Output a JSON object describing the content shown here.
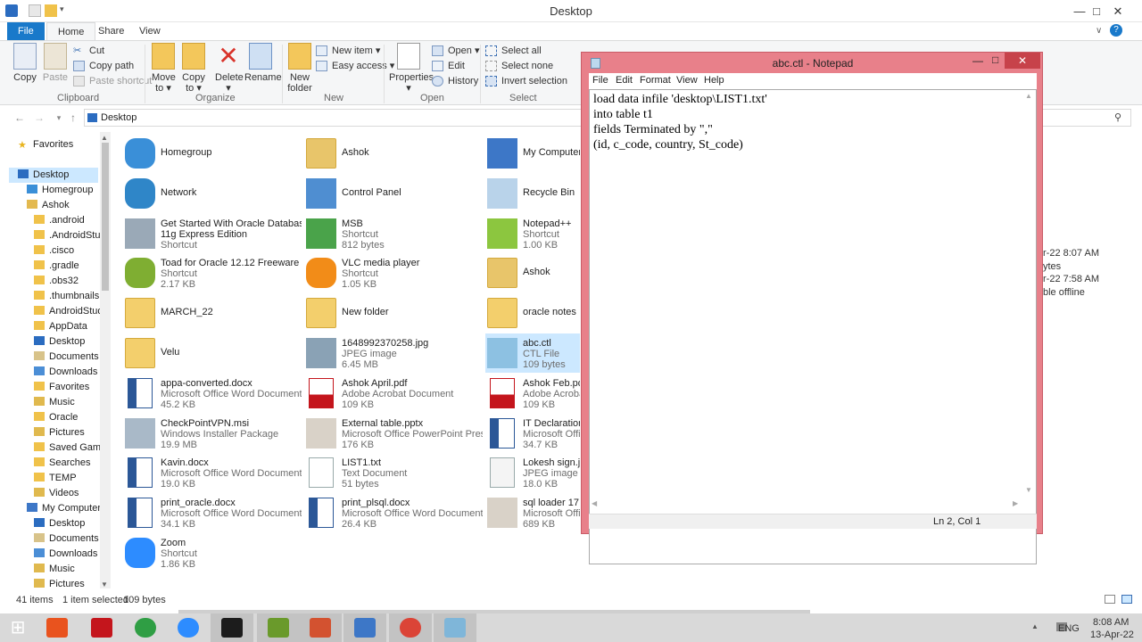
{
  "window": {
    "title": "Desktop"
  },
  "ribbon_tabs": [
    "File",
    "Home",
    "Share",
    "View"
  ],
  "ribbon": {
    "clipboard": {
      "label": "Clipboard",
      "copy": "Copy",
      "paste": "Paste",
      "cut": "Cut",
      "copy_path": "Copy path",
      "paste_shortcut": "Paste shortcut"
    },
    "organize": {
      "label": "Organize",
      "move_to_1": "Move",
      "move_to_2": "to ▾",
      "copy_to_1": "Copy",
      "copy_to_2": "to ▾",
      "delete_1": "Delete",
      "delete_2": "▾",
      "rename": "Rename"
    },
    "new": {
      "label": "New",
      "new_folder_1": "New",
      "new_folder_2": "folder",
      "new_item": "New item ▾",
      "easy_access": "Easy access ▾"
    },
    "open": {
      "label": "Open",
      "properties_1": "Properties",
      "properties_2": "▾",
      "open": "Open ▾",
      "edit": "Edit",
      "history": "History"
    },
    "select": {
      "label": "Select",
      "select_all": "Select all",
      "select_none": "Select none",
      "invert": "Invert selection"
    }
  },
  "address": {
    "path": "Desktop"
  },
  "nav": [
    {
      "label": "Favorites",
      "level": 0,
      "icon": "star-icon"
    },
    {
      "label": "Desktop",
      "level": 0,
      "icon": "desktop-icon",
      "selected": true
    },
    {
      "label": "Homegroup",
      "level": 1,
      "icon": "homegroup-icon"
    },
    {
      "label": "Ashok",
      "level": 1,
      "icon": "user-folder-icon"
    },
    {
      "label": ".android",
      "level": 2,
      "icon": "folder-icon"
    },
    {
      "label": ".AndroidStud",
      "level": 2,
      "icon": "folder-icon"
    },
    {
      "label": ".cisco",
      "level": 2,
      "icon": "folder-icon"
    },
    {
      "label": ".gradle",
      "level": 2,
      "icon": "folder-icon"
    },
    {
      "label": ".obs32",
      "level": 2,
      "icon": "folder-icon"
    },
    {
      "label": ".thumbnails",
      "level": 2,
      "icon": "folder-icon"
    },
    {
      "label": "AndroidStudi",
      "level": 2,
      "icon": "folder-icon"
    },
    {
      "label": "AppData",
      "level": 2,
      "icon": "folder-icon"
    },
    {
      "label": "Desktop",
      "level": 2,
      "icon": "desktop-icon"
    },
    {
      "label": "Documents",
      "level": 2,
      "icon": "documents-icon"
    },
    {
      "label": "Downloads",
      "level": 2,
      "icon": "downloads-icon"
    },
    {
      "label": "Favorites",
      "level": 2,
      "icon": "folder-icon"
    },
    {
      "label": "Music",
      "level": 2,
      "icon": "music-icon"
    },
    {
      "label": "Oracle",
      "level": 2,
      "icon": "folder-icon"
    },
    {
      "label": "Pictures",
      "level": 2,
      "icon": "pictures-icon"
    },
    {
      "label": "Saved Games",
      "level": 2,
      "icon": "folder-icon"
    },
    {
      "label": "Searches",
      "level": 2,
      "icon": "folder-icon"
    },
    {
      "label": "TEMP",
      "level": 2,
      "icon": "folder-icon"
    },
    {
      "label": "Videos",
      "level": 2,
      "icon": "videos-icon"
    },
    {
      "label": "My Computer",
      "level": 1,
      "icon": "computer-icon"
    },
    {
      "label": "Desktop",
      "level": 2,
      "icon": "desktop-icon"
    },
    {
      "label": "Documents",
      "level": 2,
      "icon": "documents-icon"
    },
    {
      "label": "Downloads",
      "level": 2,
      "icon": "downloads-icon"
    },
    {
      "label": "Music",
      "level": 2,
      "icon": "music-icon"
    },
    {
      "label": "Pictures",
      "level": 2,
      "icon": "pictures-icon"
    }
  ],
  "files": [
    {
      "name": "Homegroup",
      "icon": "homegroup-icon"
    },
    {
      "name": "Ashok",
      "icon": "user-folder-icon"
    },
    {
      "name": "My Computer",
      "icon": "computer-icon"
    },
    {
      "name": "Network",
      "icon": "network-icon"
    },
    {
      "name": "Control Panel",
      "icon": "control-panel-icon"
    },
    {
      "name": "Recycle Bin",
      "icon": "recycle-bin-icon"
    },
    {
      "name": "Get Started With Oracle Database",
      "name2": "11g Express Edition",
      "type": "Shortcut",
      "icon": "oracle-db-icon"
    },
    {
      "name": "MSB",
      "type": "Shortcut",
      "size": "812 bytes",
      "icon": "chart-shortcut-icon"
    },
    {
      "name": "Notepad++",
      "type": "Shortcut",
      "size": "1.00 KB",
      "icon": "notepadpp-icon"
    },
    {
      "name": "Toad for Oracle 12.12 Freeware",
      "type": "Shortcut",
      "size": "2.17 KB",
      "icon": "toad-icon"
    },
    {
      "name": "VLC media player",
      "type": "Shortcut",
      "size": "1.05 KB",
      "icon": "vlc-icon"
    },
    {
      "name": "Ashok",
      "icon": "user-folder-icon"
    },
    {
      "name": "MARCH_22",
      "icon": "folder-icon"
    },
    {
      "name": "New folder",
      "icon": "folder-icon"
    },
    {
      "name": "oracle notes",
      "icon": "folder-icon"
    },
    {
      "name": "Velu",
      "icon": "folder-icon"
    },
    {
      "name": "1648992370258.jpg",
      "type": "JPEG image",
      "size": "6.45 MB",
      "icon": "photo-icon"
    },
    {
      "name": "abc.ctl",
      "type": "CTL File",
      "size": "109 bytes",
      "icon": "ctl-file-icon",
      "selected": true
    },
    {
      "name": "appa-converted.docx",
      "type": "Microsoft Office Word Document",
      "size": "45.2 KB",
      "icon": "word-doc-icon"
    },
    {
      "name": "Ashok April.pdf",
      "type": "Adobe Acrobat Document",
      "size": "109 KB",
      "icon": "pdf-icon"
    },
    {
      "name": "Ashok Feb.pdf",
      "type": "Adobe Acroba",
      "size": "109 KB",
      "icon": "pdf-icon"
    },
    {
      "name": "CheckPointVPN.msi",
      "type": "Windows Installer Package",
      "size": "19.9 MB",
      "icon": "msi-icon"
    },
    {
      "name": "External table.pptx",
      "type": "Microsoft Office PowerPoint Pres...",
      "size": "176 KB",
      "icon": "pptx-icon"
    },
    {
      "name": "IT Declaration",
      "type": "Microsoft Offic",
      "size": "34.7 KB",
      "icon": "word-doc-icon"
    },
    {
      "name": "Kavin.docx",
      "type": "Microsoft Office Word Document",
      "size": "19.0 KB",
      "icon": "word-doc-icon"
    },
    {
      "name": "LIST1.txt",
      "type": "Text Document",
      "size": "51 bytes",
      "icon": "text-file-icon"
    },
    {
      "name": "Lokesh sign.jpg",
      "type": "JPEG image",
      "size": "18.0 KB",
      "icon": "signature-image-icon"
    },
    {
      "name": "print_oracle.docx",
      "type": "Microsoft Office Word Document",
      "size": "34.1 KB",
      "icon": "word-doc-icon"
    },
    {
      "name": "print_plsql.docx",
      "type": "Microsoft Office Word Document",
      "size": "26.4 KB",
      "icon": "word-doc-icon"
    },
    {
      "name": "sql loader 17.p",
      "type": "Microsoft Offic",
      "size": "689 KB",
      "icon": "pptx-icon"
    },
    {
      "name": "Zoom",
      "type": "Shortcut",
      "size": "1.86 KB",
      "icon": "zoom-icon"
    }
  ],
  "details_fragments": [
    "r-22 8:07 AM",
    "ytes",
    "r-22 7:58 AM",
    "ble offline"
  ],
  "notepad": {
    "title": "abc.ctl - Notepad",
    "menu": [
      "File",
      "Edit",
      "Format",
      "View",
      "Help"
    ],
    "content": "load data infile 'desktop\\LIST1.txt'\ninto table t1\nfields Terminated by \",\"\n(id, c_code, country, St_code)",
    "status": "Ln 2, Col 1"
  },
  "status": {
    "count": "41 items",
    "selection": "1 item selected",
    "size": "109 bytes"
  },
  "taskbar": [
    {
      "name": "start-icon",
      "color": "#ffffff"
    },
    {
      "name": "mi-app-icon",
      "color": "#e9531e"
    },
    {
      "name": "acrobat-icon",
      "color": "#c4151c"
    },
    {
      "name": "chrome-icon",
      "color": "#2f9e44"
    },
    {
      "name": "zoom-icon",
      "color": "#2d8cff"
    },
    {
      "name": "cmd-icon",
      "color": "#1c1c1c"
    },
    {
      "name": "toad-icon",
      "color": "#6a9a2b"
    },
    {
      "name": "powerpoint-icon",
      "color": "#d35230"
    },
    {
      "name": "explorer-icon",
      "color": "#3d77c7"
    },
    {
      "name": "chrome-icon",
      "color": "#db4437"
    },
    {
      "name": "notepad-icon",
      "color": "#7fb6d9"
    }
  ],
  "tray": {
    "lang": "ENG",
    "time": "8:08 AM",
    "date": "13-Apr-22"
  }
}
